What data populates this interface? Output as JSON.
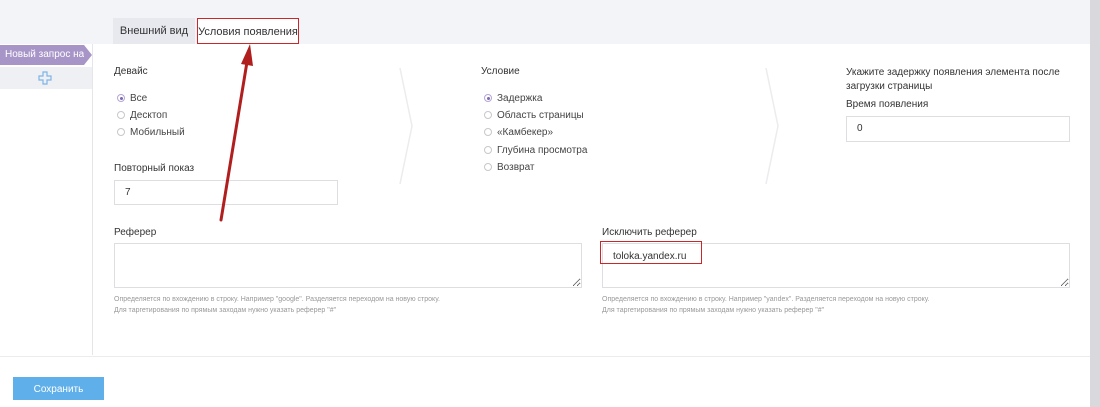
{
  "tabs": [
    {
      "label": "Внешний вид"
    },
    {
      "label": "Условия появления"
    }
  ],
  "sidebar": {
    "request_label": "Новый запрос на",
    "add_icon": "plus-icon"
  },
  "device": {
    "label": "Девайс",
    "options": [
      "Все",
      "Десктоп",
      "Мобильный"
    ],
    "selected": "Все"
  },
  "repeat": {
    "label": "Повторный показ",
    "value": "7"
  },
  "condition": {
    "label": "Условие",
    "options": [
      "Задержка",
      "Область страницы",
      "«Камбекер»",
      "Глубина просмотра",
      "Возврат"
    ],
    "selected": "Задержка"
  },
  "delay": {
    "description": "Укажите задержку появления элемента после загрузки страницы",
    "time_label": "Время появления",
    "time_value": "0"
  },
  "referrer": {
    "label": "Реферер",
    "value": "",
    "hint_line1": "Определяется по вхождению в строку. Например \"google\". Разделяется переходом на новую строку.",
    "hint_line2": "Для таргетирования по прямым заходам нужно указать реферер \"#\""
  },
  "exclude_referrer": {
    "label": "Исключить реферер",
    "value": "toloka.yandex.ru",
    "hint_line1": "Определяется по вхождению в строку. Например \"yandex\". Разделяется переходом на новую строку.",
    "hint_line2": "Для таргетирования по прямым заходам нужно указать реферер \"#\""
  },
  "save_label": "Сохранить",
  "colors": {
    "accent": "#7d68b3",
    "sidebar_item": "#a895c8",
    "save_button": "#5fb0ea",
    "annotation": "#c8282a"
  }
}
